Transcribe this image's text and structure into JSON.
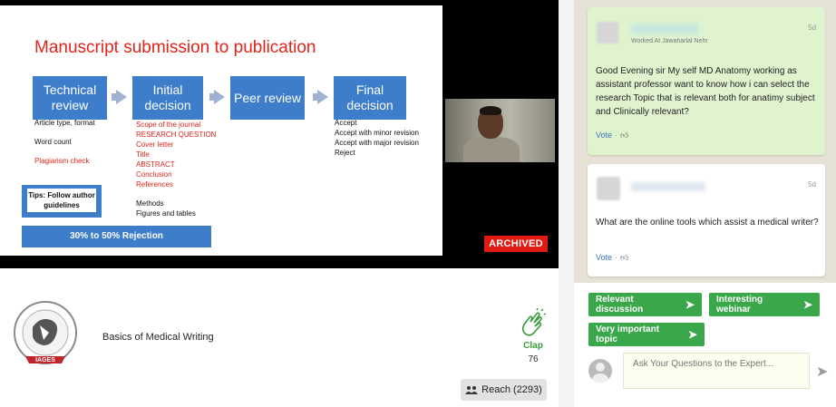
{
  "slide": {
    "title": "Manuscript submission to publication",
    "steps": [
      {
        "label": "Technical review"
      },
      {
        "label": "Initial decision"
      },
      {
        "label": "Peer review"
      },
      {
        "label": "Final decision"
      }
    ],
    "technical_items": [
      "Article type, format",
      "Word count",
      "Plagiarism check"
    ],
    "initial_items_red": [
      "Scope of the journal",
      "RESEARCH QUESTION",
      "Cover letter",
      "Title",
      "ABSTRACT",
      "Conclusion",
      "References"
    ],
    "initial_items_black": [
      "Methods",
      "Figures and tables"
    ],
    "final_items": [
      "Accept",
      "Accept with minor revision",
      "Accept with major revision",
      "Reject"
    ],
    "tips": "Tips: Follow author guidelines",
    "rejection": "30% to 50% Rejection"
  },
  "video": {
    "archived_label": "ARCHIVED"
  },
  "course": {
    "title": "Basics of Medical Writing",
    "logo_text": "IAGES"
  },
  "clap": {
    "label": "Clap",
    "count": "76"
  },
  "reach": {
    "label": "Reach (2293)"
  },
  "questions": [
    {
      "subtitle": "Worked At Jawaharlal Nehr",
      "age": "5d",
      "text": "Good Evening sir My self MD Anatomy working as assistant professor want to know how i can select the research Topic that is relevant both for anatimy subject and Clinically relevant?",
      "vote_label": "Vote"
    },
    {
      "subtitle": "",
      "age": "5d",
      "text": "What are the online tools which assist a medical writer?",
      "vote_label": "Vote"
    }
  ],
  "tags": [
    {
      "label": "Relevant discussion"
    },
    {
      "label": "Interesting webinar"
    },
    {
      "label": "Very important topic"
    }
  ],
  "ask": {
    "placeholder": "Ask Your Questions to the Expert..."
  },
  "colors": {
    "slide_blue": "#3e7dca",
    "slide_red": "#e0251b",
    "tag_green": "#3aa84a",
    "archived_red": "#e21b12",
    "question_green": "#dff3cf"
  }
}
